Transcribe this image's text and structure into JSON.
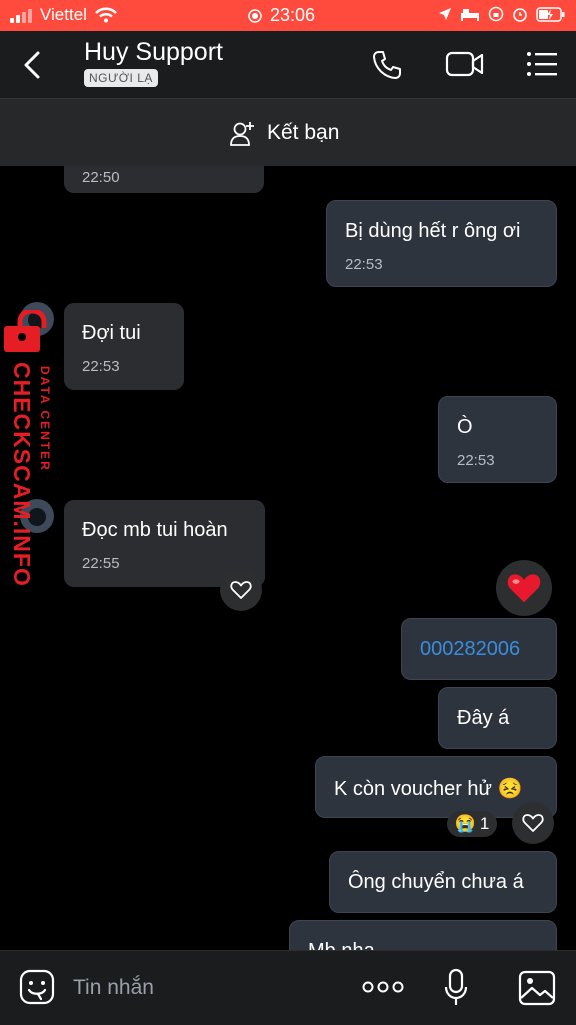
{
  "status_bar": {
    "carrier": "Viettel",
    "time": "23:06"
  },
  "header": {
    "title": "Huy Support",
    "badge": "NGƯỜI LẠ"
  },
  "friend_bar": {
    "label": "Kết bạn"
  },
  "messages": [
    {
      "direction": "in",
      "text": "",
      "time": "22:50"
    },
    {
      "direction": "out",
      "text": "Bị dùng hết r ông ơi",
      "time": "22:53"
    },
    {
      "direction": "in",
      "text": "Đợi tui",
      "time": "22:53"
    },
    {
      "direction": "out",
      "text": "Ò",
      "time": "22:53"
    },
    {
      "direction": "in",
      "text": "Đọc mb tui hoàn",
      "time": "22:55"
    },
    {
      "direction": "out",
      "text": "000282006",
      "link": true
    },
    {
      "direction": "out",
      "text": "Đây á"
    },
    {
      "direction": "out",
      "text": "K còn voucher hử 😣",
      "reaction": "😭",
      "reaction_count": "1"
    },
    {
      "direction": "out",
      "text": "Ông chuyển chưa á"
    },
    {
      "direction": "out",
      "text": "Mb nha"
    }
  ],
  "watermark": {
    "main": "CHECKSCAM.INFO",
    "sub": "DATA CENTER"
  },
  "input": {
    "placeholder": "Tin nhắn"
  },
  "colors": {
    "status_bar": "#ff4b3e",
    "link": "#3a8dde",
    "heart": "#e8192c",
    "watermark": "#e51e25"
  }
}
